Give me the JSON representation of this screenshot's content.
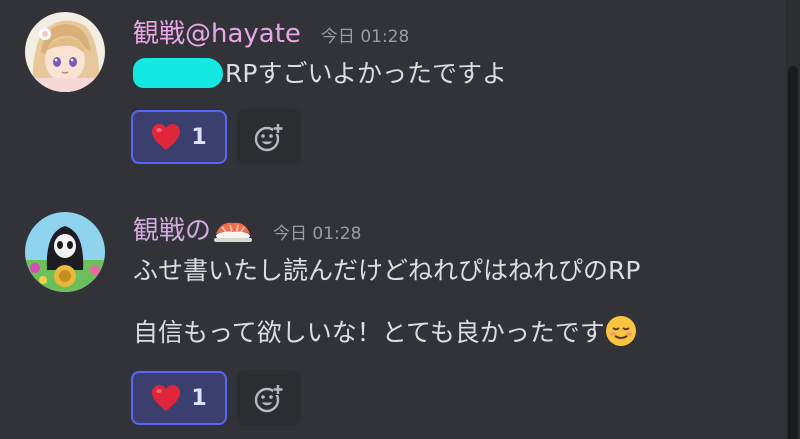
{
  "colors": {
    "background": "#313338",
    "username_pink": "#e9a7e6",
    "reaction_border": "#5865f2",
    "redaction": "#14e8e2"
  },
  "messages": [
    {
      "username": "観戦@hayate",
      "timestamp": "今日 01:28",
      "avatar_icon": "anime-girl-avatar",
      "redacted_prefix": true,
      "text": "RPすごいよかったですよ",
      "reaction": {
        "emoji": "red-heart-icon",
        "count": "1"
      },
      "add_reaction_icon": "add-reaction-smiley-icon"
    },
    {
      "username": "観戦の",
      "name_emoji": "sushi-icon",
      "timestamp": "今日 01:28",
      "avatar_icon": "reaper-character-avatar",
      "lines": [
        "ふせ書いたし読んだけどねれぴはねれぴのRP",
        "自信もって欲しいな！とても良かったです"
      ],
      "line2_emoji": "relieved-face-icon",
      "reaction": {
        "emoji": "red-heart-icon",
        "count": "1"
      },
      "add_reaction_icon": "add-reaction-smiley-icon"
    }
  ]
}
